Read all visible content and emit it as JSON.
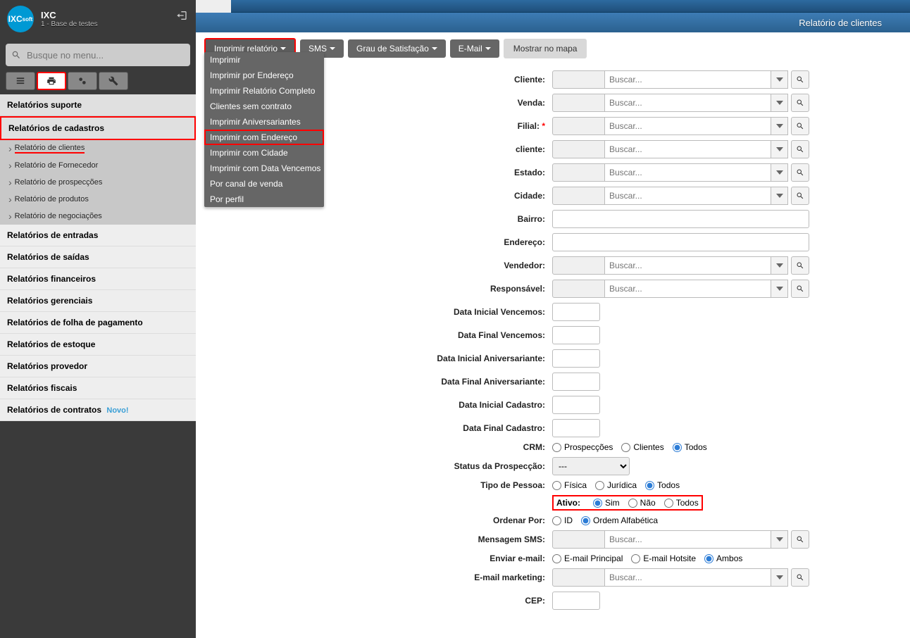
{
  "app": {
    "name": "IXC",
    "sub": "1 - Base de testes"
  },
  "search": {
    "placeholder": "Busque no menu..."
  },
  "nav": {
    "suporte": "Relatórios suporte",
    "cadastros": "Relatórios de cadastros",
    "items": [
      "Relatório de clientes",
      "Relatório de Fornecedor",
      "Relatório de prospecções",
      "Relatório de produtos",
      "Relatório de negociações"
    ],
    "others": [
      "Relatórios de entradas",
      "Relatórios de saídas",
      "Relatórios financeiros",
      "Relatórios gerenciais",
      "Relatórios de folha de pagamento",
      "Relatórios de estoque",
      "Relatórios provedor",
      "Relatórios fiscais",
      "Relatórios de contratos"
    ],
    "novo": "Novo!"
  },
  "page_title": "Relatório de clientes",
  "toolbar": {
    "imprimir": "Imprimir relatório",
    "sms": "SMS",
    "grau": "Grau de Satisfação",
    "email": "E-Mail",
    "mapa": "Mostrar no mapa"
  },
  "dropdown": [
    "Imprimir",
    "Imprimir por Endereço",
    "Imprimir Relatório Completo",
    "Clientes sem contrato",
    "Imprimir Aniversariantes",
    "Imprimir com Endereço",
    "Imprimir com Cidade",
    "Imprimir com Data Vencemos",
    "Por canal de venda",
    "Por perfil"
  ],
  "form": {
    "cliente": "Cliente:",
    "venda": "Venda:",
    "filial": "Filial:",
    "tipo_cliente": "cliente:",
    "estado": "Estado:",
    "cidade": "Cidade:",
    "bairro": "Bairro:",
    "endereco": "Endereço:",
    "vendedor": "Vendedor:",
    "responsavel": "Responsável:",
    "data_ini_venc": "Data Inicial Vencemos:",
    "data_fin_venc": "Data Final Vencemos:",
    "data_ini_aniv": "Data Inicial Aniversariante:",
    "data_fin_aniv": "Data Final Aniversariante:",
    "data_ini_cad": "Data Inicial Cadastro:",
    "data_fin_cad": "Data Final Cadastro:",
    "crm": "CRM:",
    "crm_opts": [
      "Prospecções",
      "Clientes",
      "Todos"
    ],
    "status_prosp": "Status da Prospecção:",
    "status_default": "---",
    "tipo_pessoa": "Tipo de Pessoa:",
    "tipo_pessoa_opts": [
      "Física",
      "Jurídica",
      "Todos"
    ],
    "ativo": "Ativo:",
    "ativo_opts": [
      "Sim",
      "Não",
      "Todos"
    ],
    "ordenar": "Ordenar Por:",
    "ordenar_opts": [
      "ID",
      "Ordem Alfabética"
    ],
    "msg_sms": "Mensagem SMS:",
    "enviar_email": "Enviar e-mail:",
    "email_opts": [
      "E-mail Principal",
      "E-mail Hotsite",
      "Ambos"
    ],
    "email_mkt": "E-mail marketing:",
    "cep": "CEP:",
    "buscar": "Buscar..."
  }
}
